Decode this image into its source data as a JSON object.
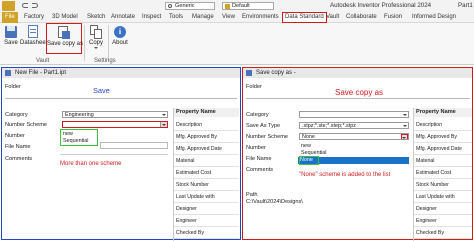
{
  "titlebar": {
    "search_value": "Generic",
    "project_value": "Default",
    "app_title": "Autodesk Inventor Professional 2024",
    "doc_title": "Part1"
  },
  "tabs": [
    "File",
    "Factory",
    "3D Model",
    "Sketch",
    "Annotate",
    "Inspect",
    "Tools",
    "Manage",
    "View",
    "Environments",
    "Data Standard",
    "Vault",
    "Collaborate",
    "Fusion",
    "Informed Design"
  ],
  "ribbon": {
    "save": "Save",
    "datasheet": "Datasheet",
    "save_copy_as": "Save copy as",
    "copy": "Copy",
    "about": "About",
    "group_vault": "Vault",
    "group_settings": "Settings"
  },
  "left_dialog": {
    "title": "New File - Part1.ipt",
    "folder_label": "Folder",
    "annotation": "Save",
    "category_label": "Category",
    "category_value": "Engineering",
    "scheme_label": "Number Scheme",
    "number_label": "Number",
    "filename_label": "File Name",
    "comments_label": "Comments",
    "options": [
      "new",
      "Sequential"
    ],
    "note": "More than one scheme",
    "prop_header": "Property Name",
    "props": [
      "Description",
      "Mfg. Approved By",
      "Mfg. Approved Date",
      "Material",
      "Estimated Cost",
      "Stock Number",
      "Last Update with",
      "Designer",
      "Engineer",
      "Checked By"
    ]
  },
  "right_dialog": {
    "title": "Save copy as -",
    "folder_label": "Folder",
    "annotation": "Save copy as",
    "category_label": "Category",
    "save_as_type_label": "Save As Type",
    "save_as_type_value": ".stpz;*.ste;*.step;*.stpz",
    "scheme_label": "Number Scheme",
    "scheme_value": "None",
    "number_label": "Number",
    "filename_label": "File Name",
    "comments_label": "Comments",
    "options": [
      "new",
      "Sequential",
      "None"
    ],
    "note": "\"None\" scheme is added to the list",
    "path_label": "Path",
    "path_value": "C:\\Vault\\2024\\Designs\\",
    "prop_header": "Property Name",
    "props": [
      "Description",
      "Mfg. Approved By",
      "Mfg. Approved Date",
      "Material",
      "Estimated Cost",
      "Stock Number",
      "Last Update with",
      "Designer",
      "Engineer",
      "Checked By"
    ]
  },
  "colors": {
    "accent_red": "#d21c1c",
    "accent_blue": "#2546c9",
    "highlight": "#1a73c8",
    "file_tab": "#d1a228",
    "green_box": "#3cc23c"
  }
}
